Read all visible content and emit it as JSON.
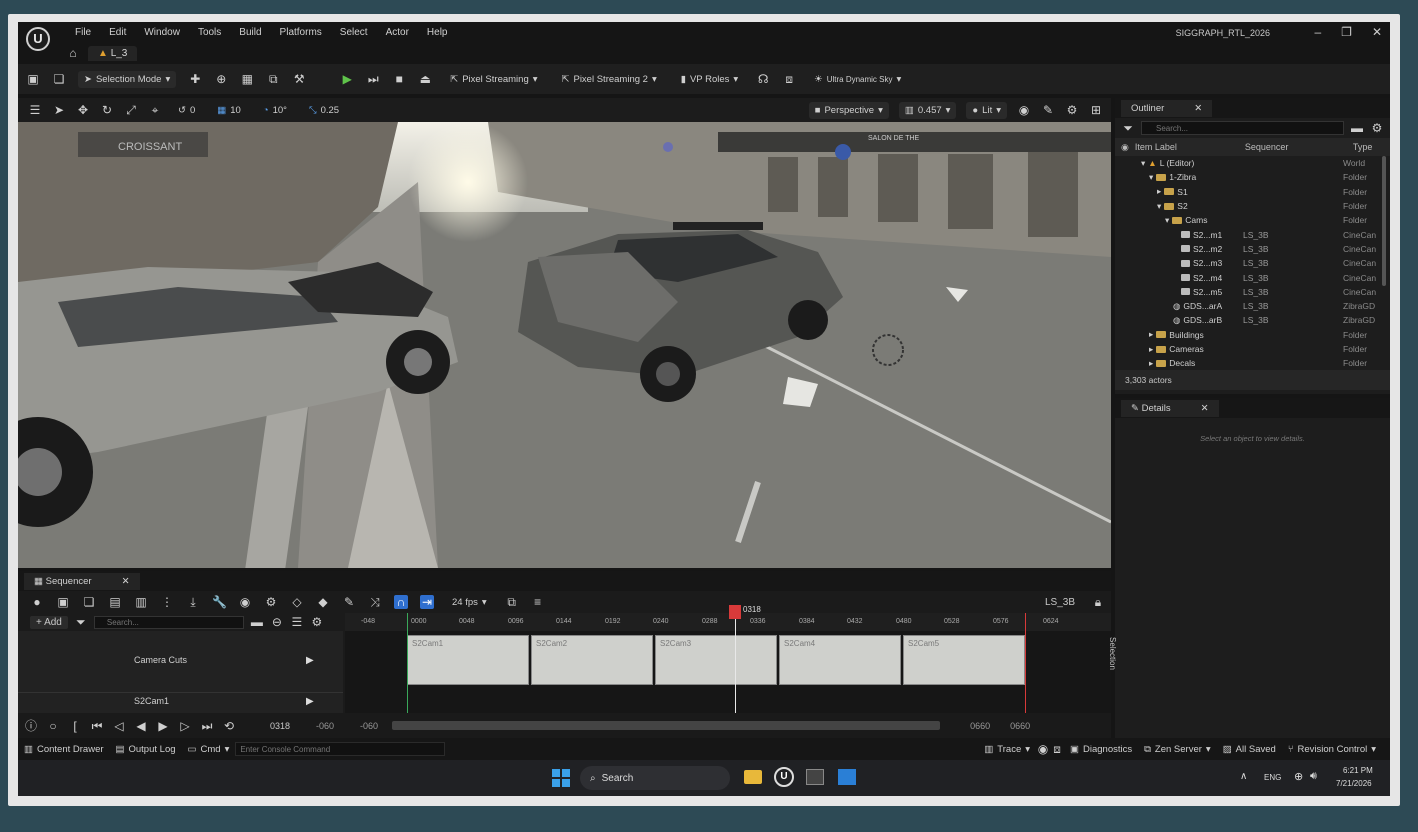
{
  "window": {
    "project": "SIGGRAPH_RTL_2026",
    "tab": "L_3",
    "menu": [
      "File",
      "Edit",
      "Window",
      "Tools",
      "Build",
      "Platforms",
      "Select",
      "Actor",
      "Help"
    ]
  },
  "toolbar": {
    "selection_mode": "Selection Mode",
    "pixel_streaming": "Pixel Streaming",
    "pixel_streaming2": "Pixel Streaming 2",
    "vp_roles": "VP Roles",
    "sky": "Ultra Dynamic Sky"
  },
  "viewport": {
    "snap_angle": "10°",
    "snap_grid": "10",
    "snap_scale": "0.25",
    "rot_val": "0",
    "perspective": "Perspective",
    "camera_speed": "0.457",
    "lit": "Lit",
    "sign_croissant": "CROISSANT",
    "sign_salon": "SALON DE THE"
  },
  "outliner": {
    "title": "Outliner",
    "search_placeholder": "Search...",
    "col_label": "Item Label",
    "col_seq": "Sequencer",
    "col_type": "Type",
    "rows": [
      {
        "label": "L (Editor)",
        "seq": "",
        "type": "World"
      },
      {
        "label": "1-Zibra",
        "seq": "",
        "type": "Folder"
      },
      {
        "label": "S1",
        "seq": "",
        "type": "Folder"
      },
      {
        "label": "S2",
        "seq": "",
        "type": "Folder"
      },
      {
        "label": "Cams",
        "seq": "",
        "type": "Folder"
      },
      {
        "label": "S2...m1",
        "seq": "LS_3B",
        "type": "CineCan"
      },
      {
        "label": "S2...m2",
        "seq": "LS_3B",
        "type": "CineCan"
      },
      {
        "label": "S2...m3",
        "seq": "LS_3B",
        "type": "CineCan"
      },
      {
        "label": "S2...m4",
        "seq": "LS_3B",
        "type": "CineCan"
      },
      {
        "label": "S2...m5",
        "seq": "LS_3B",
        "type": "CineCan"
      },
      {
        "label": "GDS...arA",
        "seq": "LS_3B",
        "type": "ZibraGD"
      },
      {
        "label": "GDS...arB",
        "seq": "LS_3B",
        "type": "ZibraGD"
      },
      {
        "label": "Buildings",
        "seq": "",
        "type": "Folder"
      },
      {
        "label": "Cameras",
        "seq": "",
        "type": "Folder"
      },
      {
        "label": "Decals",
        "seq": "",
        "type": "Folder"
      }
    ],
    "actors": "3,303 actors"
  },
  "details": {
    "title": "Details",
    "empty": "Select an object to view details."
  },
  "sequencer": {
    "title": "Sequencer",
    "fps": "24 fps",
    "sequence_name": "LS_3B",
    "add": "+ Add",
    "search_placeholder": "Search...",
    "track1": "Camera Cuts",
    "track2": "S2Cam1",
    "playhead": "0318",
    "frame_current": "0318",
    "range_start": "-060",
    "range_start2": "-060",
    "range_end": "0660",
    "range_end2": "0660",
    "selection": "Selection",
    "ruler": [
      "-048",
      "0000",
      "0048",
      "0096",
      "0144",
      "0192",
      "0240",
      "0288",
      "0336",
      "0384",
      "0432",
      "0480",
      "0528",
      "0576",
      "0624"
    ],
    "shots": [
      "S2Cam1",
      "S2Cam2",
      "S2Cam3",
      "S2Cam4",
      "S2Cam5"
    ]
  },
  "statusbar": {
    "content_drawer": "Content Drawer",
    "output_log": "Output Log",
    "cmd": "Cmd",
    "console_placeholder": "Enter Console Command",
    "trace": "Trace",
    "diagnostics": "Diagnostics",
    "zen": "Zen Server",
    "saved": "All Saved",
    "revision": "Revision Control"
  },
  "taskbar": {
    "search": "Search",
    "lang": "ENG",
    "time": "6:21 PM",
    "date": "7/21/2026"
  },
  "colors": {
    "accent": "#d83a3a",
    "select": "#2b3d57",
    "folder": "#c7a24a"
  }
}
